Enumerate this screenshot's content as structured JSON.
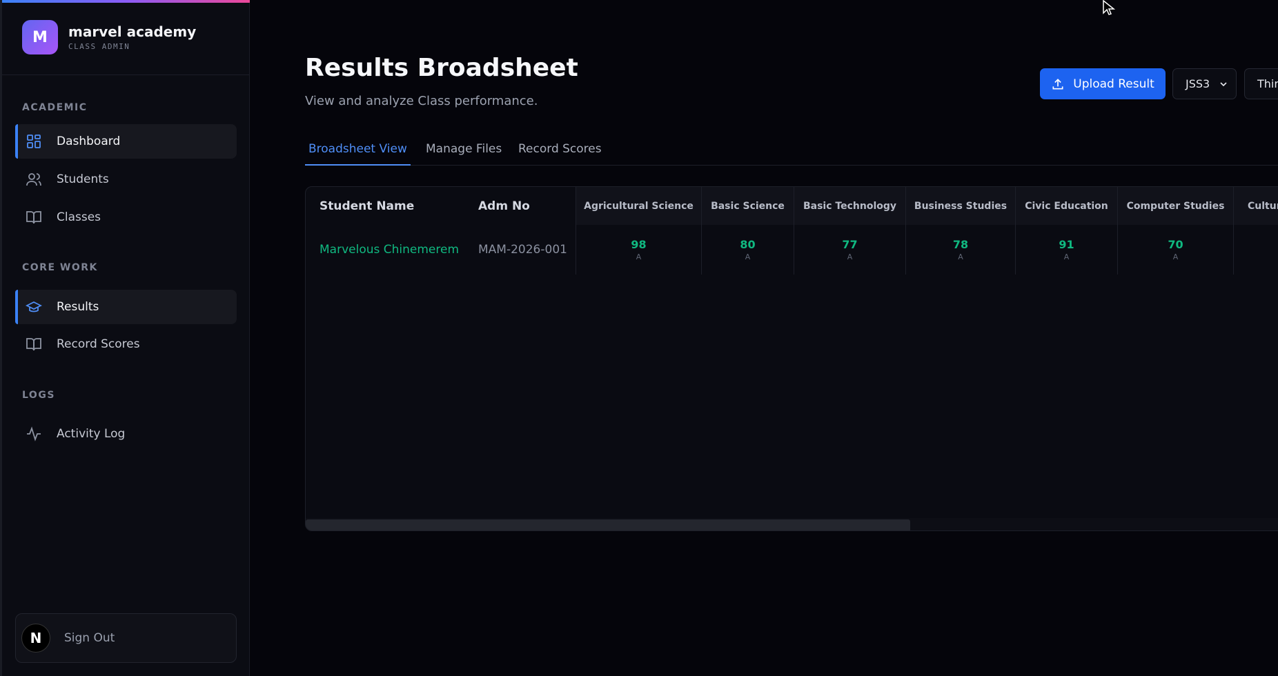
{
  "sidebar": {
    "brand": {
      "initial": "M",
      "name": "marvel academy",
      "role": "CLASS ADMIN"
    },
    "sections": [
      {
        "label": "ACADEMIC",
        "items": [
          {
            "label": "Dashboard",
            "icon": "grid-icon",
            "active": true
          },
          {
            "label": "Students",
            "icon": "users-icon",
            "active": false
          },
          {
            "label": "Classes",
            "icon": "book-icon",
            "active": false
          }
        ]
      },
      {
        "label": "CORE WORK",
        "items": [
          {
            "label": "Results",
            "icon": "graduation-cap-icon",
            "active": true
          },
          {
            "label": "Record Scores",
            "icon": "book-icon",
            "active": false
          }
        ]
      },
      {
        "label": "LOGS",
        "items": [
          {
            "label": "Activity Log",
            "icon": "activity-icon",
            "active": false
          }
        ]
      }
    ],
    "signout": {
      "avatar": "N",
      "label": "Sign Out"
    }
  },
  "header": {
    "title": "Results Broadsheet",
    "subtitle": "View and analyze Class performance.",
    "upload_label": "Upload Result",
    "class_select": "JSS3",
    "term_select": "Thir"
  },
  "tabs": [
    {
      "label": "Broadsheet View",
      "active": true
    },
    {
      "label": "Manage Files",
      "active": false
    },
    {
      "label": "Record Scores",
      "active": false
    }
  ],
  "table": {
    "headers": {
      "name": "Student Name",
      "adm": "Adm No",
      "subjects": [
        "Agricultural Science",
        "Basic Science",
        "Basic Technology",
        "Business Studies",
        "Civic Education",
        "Computer Studies",
        "Cultur"
      ]
    },
    "rows": [
      {
        "name": "Marvelous Chinemerem",
        "adm": "MAM-2026-001",
        "scores": [
          {
            "score": "98",
            "grade": "A"
          },
          {
            "score": "80",
            "grade": "A"
          },
          {
            "score": "77",
            "grade": "A"
          },
          {
            "score": "78",
            "grade": "A"
          },
          {
            "score": "91",
            "grade": "A"
          },
          {
            "score": "70",
            "grade": "A"
          }
        ]
      }
    ]
  },
  "colors": {
    "accent": "#1d63f0",
    "success": "#10b981",
    "background": "#05050b"
  }
}
